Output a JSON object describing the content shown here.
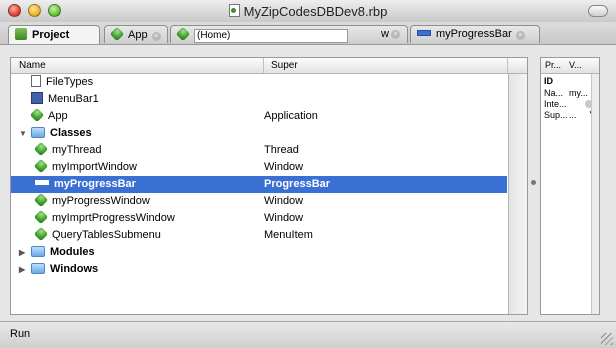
{
  "window": {
    "title": "MyZipCodesDBDev8.rbp"
  },
  "tabs": [
    {
      "label": "Project",
      "icon": "project-icon",
      "active": true
    },
    {
      "label": "App",
      "icon": "cube-icon",
      "active": false
    },
    {
      "label": "(Home)",
      "icon": "cube-icon",
      "active": false,
      "suffix": "w"
    },
    {
      "label": "myProgressBar",
      "icon": "progressbar-icon",
      "active": false
    }
  ],
  "table": {
    "headers": {
      "name": "Name",
      "super": "Super"
    },
    "rows": [
      {
        "name": "FileTypes",
        "super": "",
        "icon": "file-icon",
        "indent": 0,
        "bold": false,
        "disclosure": ""
      },
      {
        "name": "MenuBar1",
        "super": "",
        "icon": "menubar-icon",
        "indent": 0,
        "bold": false,
        "disclosure": ""
      },
      {
        "name": "App",
        "super": "Application",
        "icon": "cube-icon",
        "indent": 0,
        "bold": false,
        "disclosure": ""
      },
      {
        "name": "Classes",
        "super": "",
        "icon": "folder-icon",
        "indent": 0,
        "bold": true,
        "disclosure": "expanded"
      },
      {
        "name": "myThread",
        "super": "Thread",
        "icon": "cube-icon",
        "indent": 1,
        "bold": false,
        "disclosure": ""
      },
      {
        "name": "myImportWindow",
        "super": "Window",
        "icon": "cube-icon",
        "indent": 1,
        "bold": false,
        "disclosure": ""
      },
      {
        "name": "myProgressBar",
        "super": "ProgressBar",
        "icon": "progressbar-icon",
        "indent": 1,
        "bold": true,
        "selected": true,
        "disclosure": ""
      },
      {
        "name": "myProgressWindow",
        "super": "Window",
        "icon": "cube-icon",
        "indent": 1,
        "bold": false,
        "disclosure": ""
      },
      {
        "name": "myImprtProgressWindow",
        "super": "Window",
        "icon": "cube-icon",
        "indent": 1,
        "bold": false,
        "disclosure": ""
      },
      {
        "name": "QueryTablesSubmenu",
        "super": "MenuItem",
        "icon": "cube-icon",
        "indent": 1,
        "bold": false,
        "disclosure": ""
      },
      {
        "name": "Modules",
        "super": "",
        "icon": "folder-icon",
        "indent": 0,
        "bold": true,
        "disclosure": "collapsed"
      },
      {
        "name": "Windows",
        "super": "",
        "icon": "folder-icon",
        "indent": 0,
        "bold": true,
        "disclosure": "collapsed"
      }
    ]
  },
  "properties": {
    "headers": {
      "property": "Pr...",
      "value": "V..."
    },
    "rows": [
      {
        "label": "ID",
        "value": "",
        "bold": true
      },
      {
        "label": "Na...",
        "value": "my...",
        "bold": false
      },
      {
        "label": "Inte...",
        "value": "",
        "bold": false,
        "widget": "circle"
      },
      {
        "label": "Sup...",
        "value": "...",
        "bold": false,
        "widget": "triangle"
      }
    ]
  },
  "status": {
    "text": "Run"
  },
  "colors": {
    "selection": "#3a6fd4",
    "window_bg": "#e6e6e6"
  }
}
